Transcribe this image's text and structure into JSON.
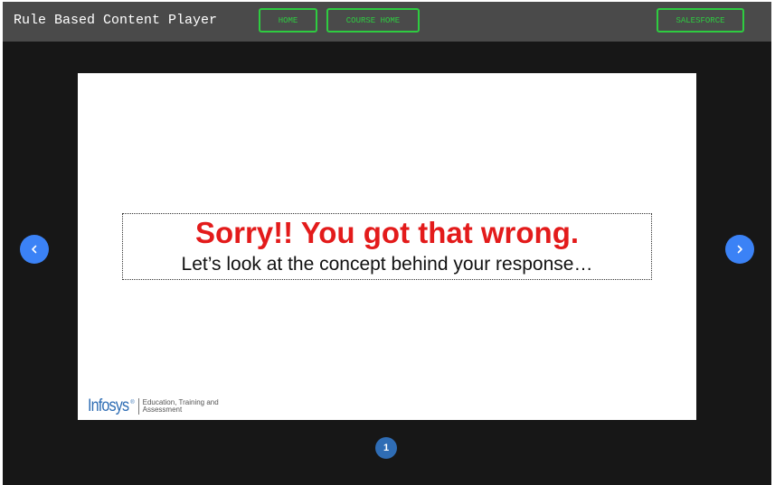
{
  "app": {
    "title": "Rule Based Content Player"
  },
  "nav": {
    "home_label": "HOME",
    "course_home_label": "COURSE HOME",
    "salesforce_label": "SALESFORCE"
  },
  "slide": {
    "headline": "Sorry!! You got that wrong.",
    "subtext": "Let’s look at the concept behind your response…",
    "brand": {
      "logo": "Infosys",
      "registered": "®",
      "tagline_line1": "Education, Training and",
      "tagline_line2": "Assessment"
    }
  },
  "pagination": {
    "current_page": "1"
  },
  "icons": {
    "prev": "chevron-left-icon",
    "next": "chevron-right-icon"
  },
  "colors": {
    "topbar": "#4a4a4a",
    "background": "#171717",
    "button_accent": "#2ecc40",
    "headline": "#e31b1b",
    "arrow": "#3b82f6",
    "page_dot": "#2f6db5",
    "brand": "#2e6db4"
  }
}
